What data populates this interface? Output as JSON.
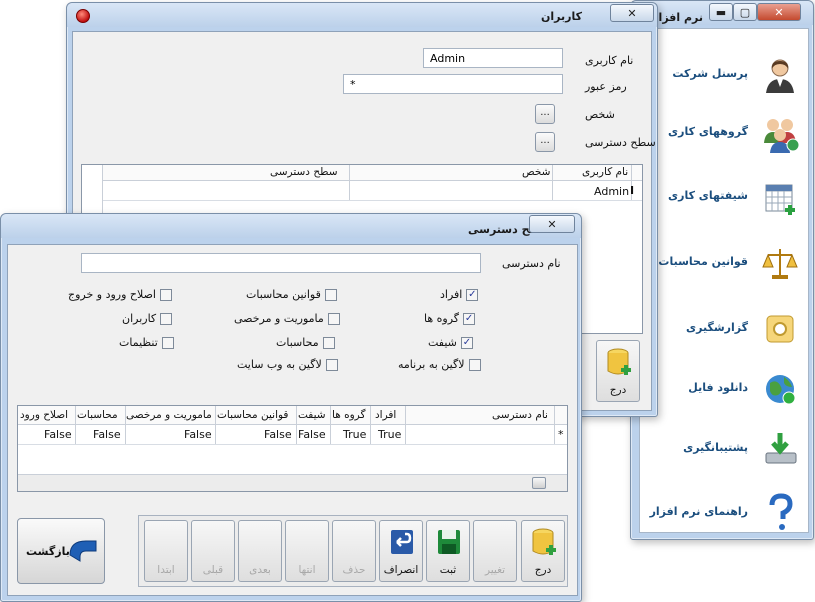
{
  "main_window": {
    "title": "نرم افزار ح",
    "sidebar": {
      "items": [
        {
          "label": "پرسنل شرکت",
          "icon": "person-icon"
        },
        {
          "label": "گروههای کاری",
          "icon": "group-icon"
        },
        {
          "label": "شیفتهای کاری",
          "icon": "calendar-grid-icon"
        },
        {
          "label": "قوانین محاسبات",
          "icon": "scales-icon"
        },
        {
          "label": "گزارشگیری",
          "icon": "report-icon"
        },
        {
          "label": "دانلود فایل",
          "icon": "globe-icon"
        },
        {
          "label": "پشتیبانگیری",
          "icon": "backup-icon"
        },
        {
          "label": "راهنمای نرم افزار",
          "icon": "help-icon"
        }
      ]
    }
  },
  "users_window": {
    "title": "کاربران",
    "form": {
      "username_label": "نام کاربری",
      "username_value": "Admin",
      "password_label": "رمز عبور",
      "password_value": "*",
      "person_label": "شخص",
      "access_label": "سطح دسترسی",
      "browse_label": "..."
    },
    "grid": {
      "headers": [
        "نام کاربری",
        "شخص",
        "سطح دسترسی"
      ],
      "rows": [
        [
          "Admin",
          "",
          ""
        ]
      ],
      "cursor": "I"
    },
    "insert_label": "درج"
  },
  "access_window": {
    "title": "سطح دسترسی",
    "name_label": "نام دسترسی",
    "name_value": "",
    "checkboxes": [
      {
        "label": "افراد",
        "checked": true
      },
      {
        "label": "گروه ها",
        "checked": true
      },
      {
        "label": "شیفت",
        "checked": true
      },
      {
        "label": "لاگین به برنامه",
        "checked": false
      },
      {
        "label": "قوانین محاسبات",
        "checked": false
      },
      {
        "label": "ماموریت و مرخصی",
        "checked": false
      },
      {
        "label": "محاسبات",
        "checked": false
      },
      {
        "label": "لاگین به وب سایت",
        "checked": false
      },
      {
        "label": "اصلاح ورود و خروج",
        "checked": false
      },
      {
        "label": "کاربران",
        "checked": false
      },
      {
        "label": "تنظیمات",
        "checked": false
      }
    ],
    "grid": {
      "headers": [
        "نام دسترسی",
        "افراد",
        "گروه ها",
        "شیفت",
        "قوانین محاسبات",
        "ماموریت و مرخصی",
        "محاسبات",
        "اصلاح ورود"
      ],
      "row_marker": "*",
      "row": [
        "",
        "True",
        "True",
        "False",
        "False",
        "False",
        "False",
        "False"
      ]
    },
    "toolbar": {
      "insert": "درج",
      "edit": "تغییر",
      "save": "ثبت",
      "cancel": "انصراف",
      "delete": "حذف",
      "last": "انتها",
      "next": "بعدی",
      "prev": "قبلی",
      "first": "ابتدا"
    },
    "back_label": "بازگشت"
  },
  "colors": {
    "window_frame": "#bcd2ec",
    "sidebar_text": "#1b4e7e",
    "client_bg": "#f0f0f0"
  }
}
